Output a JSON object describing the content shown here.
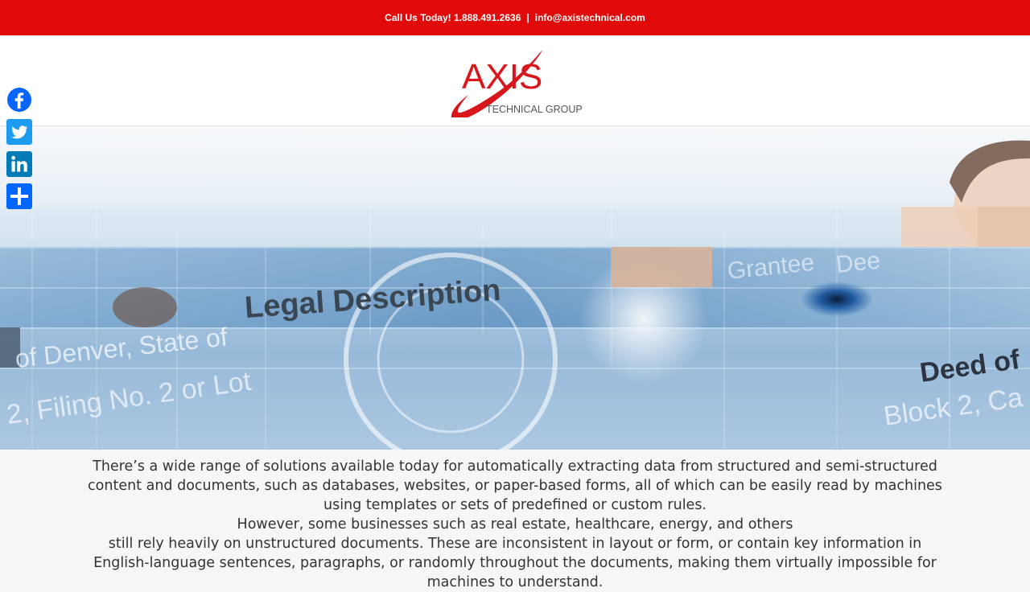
{
  "topbar": {
    "call_text": "Call Us Today! 1.888.491.2636",
    "separator": "|",
    "email": "info@axistechnical.com"
  },
  "logo": {
    "brand": "AXIS",
    "subtitle": "TECHNICAL GROUP"
  },
  "social": [
    "facebook-icon",
    "twitter-icon",
    "linkedin-icon",
    "share-icon"
  ],
  "hero": {
    "text_fragments": [
      "Legal Description",
      "Deed of",
      "of Denver, State of",
      "2, Filing No. 2 or Lot",
      "Block 2, Ca",
      "Grantee",
      "Dee"
    ]
  },
  "content": {
    "paragraph1": "There’s a wide range of solutions available today for automatically extracting data from structured and semi-structured content and documents, such as databases, websites, or paper-based forms, all of which can be easily read by  machines using templates or sets of predefined or custom rules.",
    "paragraph2": "However, some businesses such as real estate, healthcare, energy, and others",
    "paragraph3": "still rely heavily on unstructured documents. These are inconsistent in layout or form, or contain key information in English-language sentences, paragraphs, or randomly throughout the documents, making them virtually impossible for machines to understand."
  },
  "colors": {
    "topbar": "#e00a0a",
    "brand_red": "#d9161c",
    "facebook": "#0866ff",
    "twitter": "#1d9bf0",
    "linkedin": "#007bb5",
    "share": "#0166ff"
  }
}
